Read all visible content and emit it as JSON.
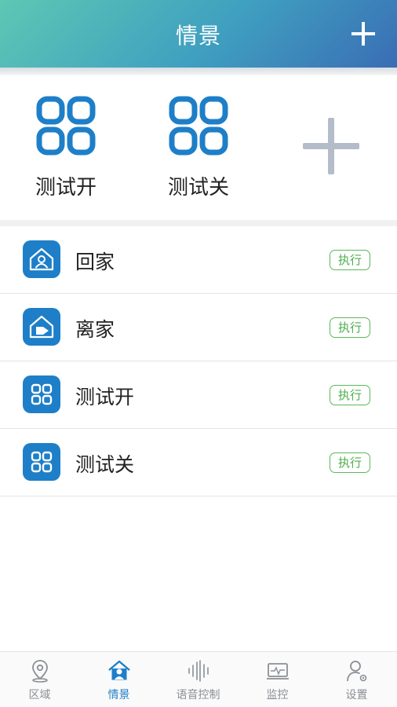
{
  "header": {
    "title": "情景",
    "add_icon": "plus-icon"
  },
  "quick_scenes": {
    "items": [
      {
        "label": "测试开",
        "icon": "grid-icon"
      },
      {
        "label": "测试关",
        "icon": "grid-icon"
      }
    ],
    "add_icon": "plus-icon"
  },
  "scene_list": {
    "execute_label": "执行",
    "items": [
      {
        "label": "回家",
        "icon": "home-person-icon"
      },
      {
        "label": "离家",
        "icon": "home-exit-icon"
      },
      {
        "label": "测试开",
        "icon": "grid-icon"
      },
      {
        "label": "测试关",
        "icon": "grid-icon"
      }
    ]
  },
  "bottom_nav": {
    "items": [
      {
        "label": "区域",
        "icon": "location-pin-icon",
        "active": false
      },
      {
        "label": "情景",
        "icon": "scene-home-icon",
        "active": true
      },
      {
        "label": "语音控制",
        "icon": "voice-wave-icon",
        "active": false
      },
      {
        "label": "监控",
        "icon": "monitor-icon",
        "active": false
      },
      {
        "label": "设置",
        "icon": "user-settings-icon",
        "active": false
      }
    ]
  },
  "colors": {
    "accent": "#1e7fc8",
    "execute_green": "#4cae4c",
    "nav_inactive": "#8a8f94",
    "plus_gray": "#b3bcc8"
  }
}
